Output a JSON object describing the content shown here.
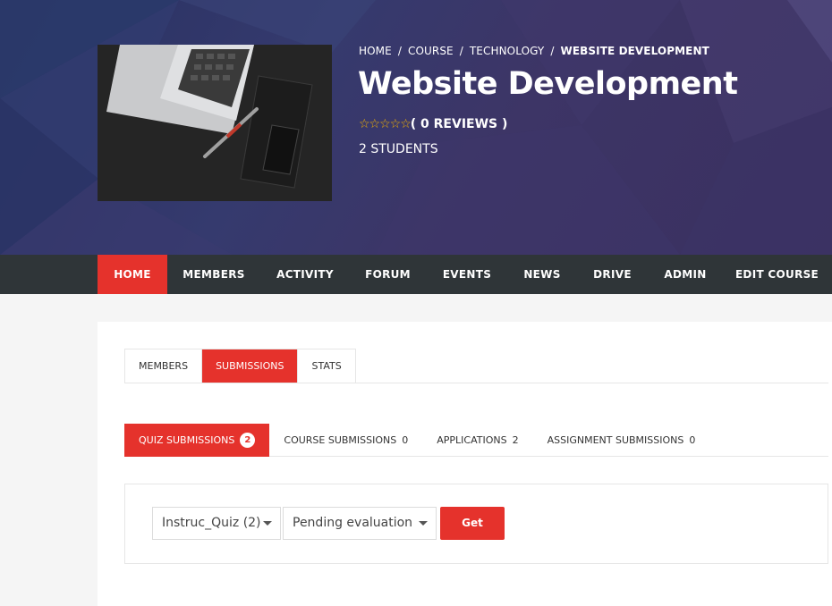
{
  "colors": {
    "accent": "#e5322c",
    "nav_bg": "#2f3538",
    "hero_bg": "#353a6e",
    "star": "#f4b400"
  },
  "breadcrumb": {
    "items": [
      "HOME",
      "COURSE",
      "TECHNOLOGY"
    ],
    "separator": "/",
    "current": "WEBSITE DEVELOPMENT"
  },
  "course": {
    "title": "Website Development",
    "stars": "☆☆☆☆☆",
    "reviews": "( 0 REVIEWS )",
    "students": "2 STUDENTS",
    "image_icon": "laptop-image"
  },
  "nav": {
    "items": [
      {
        "label": "HOME",
        "active": true
      },
      {
        "label": "MEMBERS"
      },
      {
        "label": "ACTIVITY"
      },
      {
        "label": "FORUM"
      },
      {
        "label": "EVENTS"
      },
      {
        "label": "NEWS"
      },
      {
        "label": "DRIVE"
      },
      {
        "label": "ADMIN"
      },
      {
        "label": "EDIT COURSE"
      }
    ]
  },
  "subtabs": {
    "items": [
      {
        "label": "MEMBERS"
      },
      {
        "label": "SUBMISSIONS",
        "active": true
      },
      {
        "label": "STATS"
      }
    ]
  },
  "submission_tabs": {
    "items": [
      {
        "label": "QUIZ SUBMISSIONS",
        "count": "2",
        "active": true
      },
      {
        "label": "COURSE SUBMISSIONS",
        "count": "0"
      },
      {
        "label": "APPLICATIONS",
        "count": "2"
      },
      {
        "label": "ASSIGNMENT SUBMISSIONS",
        "count": "0"
      }
    ]
  },
  "filters": {
    "quiz_select": "Instruc_Quiz (2)",
    "status_select": "Pending evaluation",
    "get_label": "Get"
  }
}
